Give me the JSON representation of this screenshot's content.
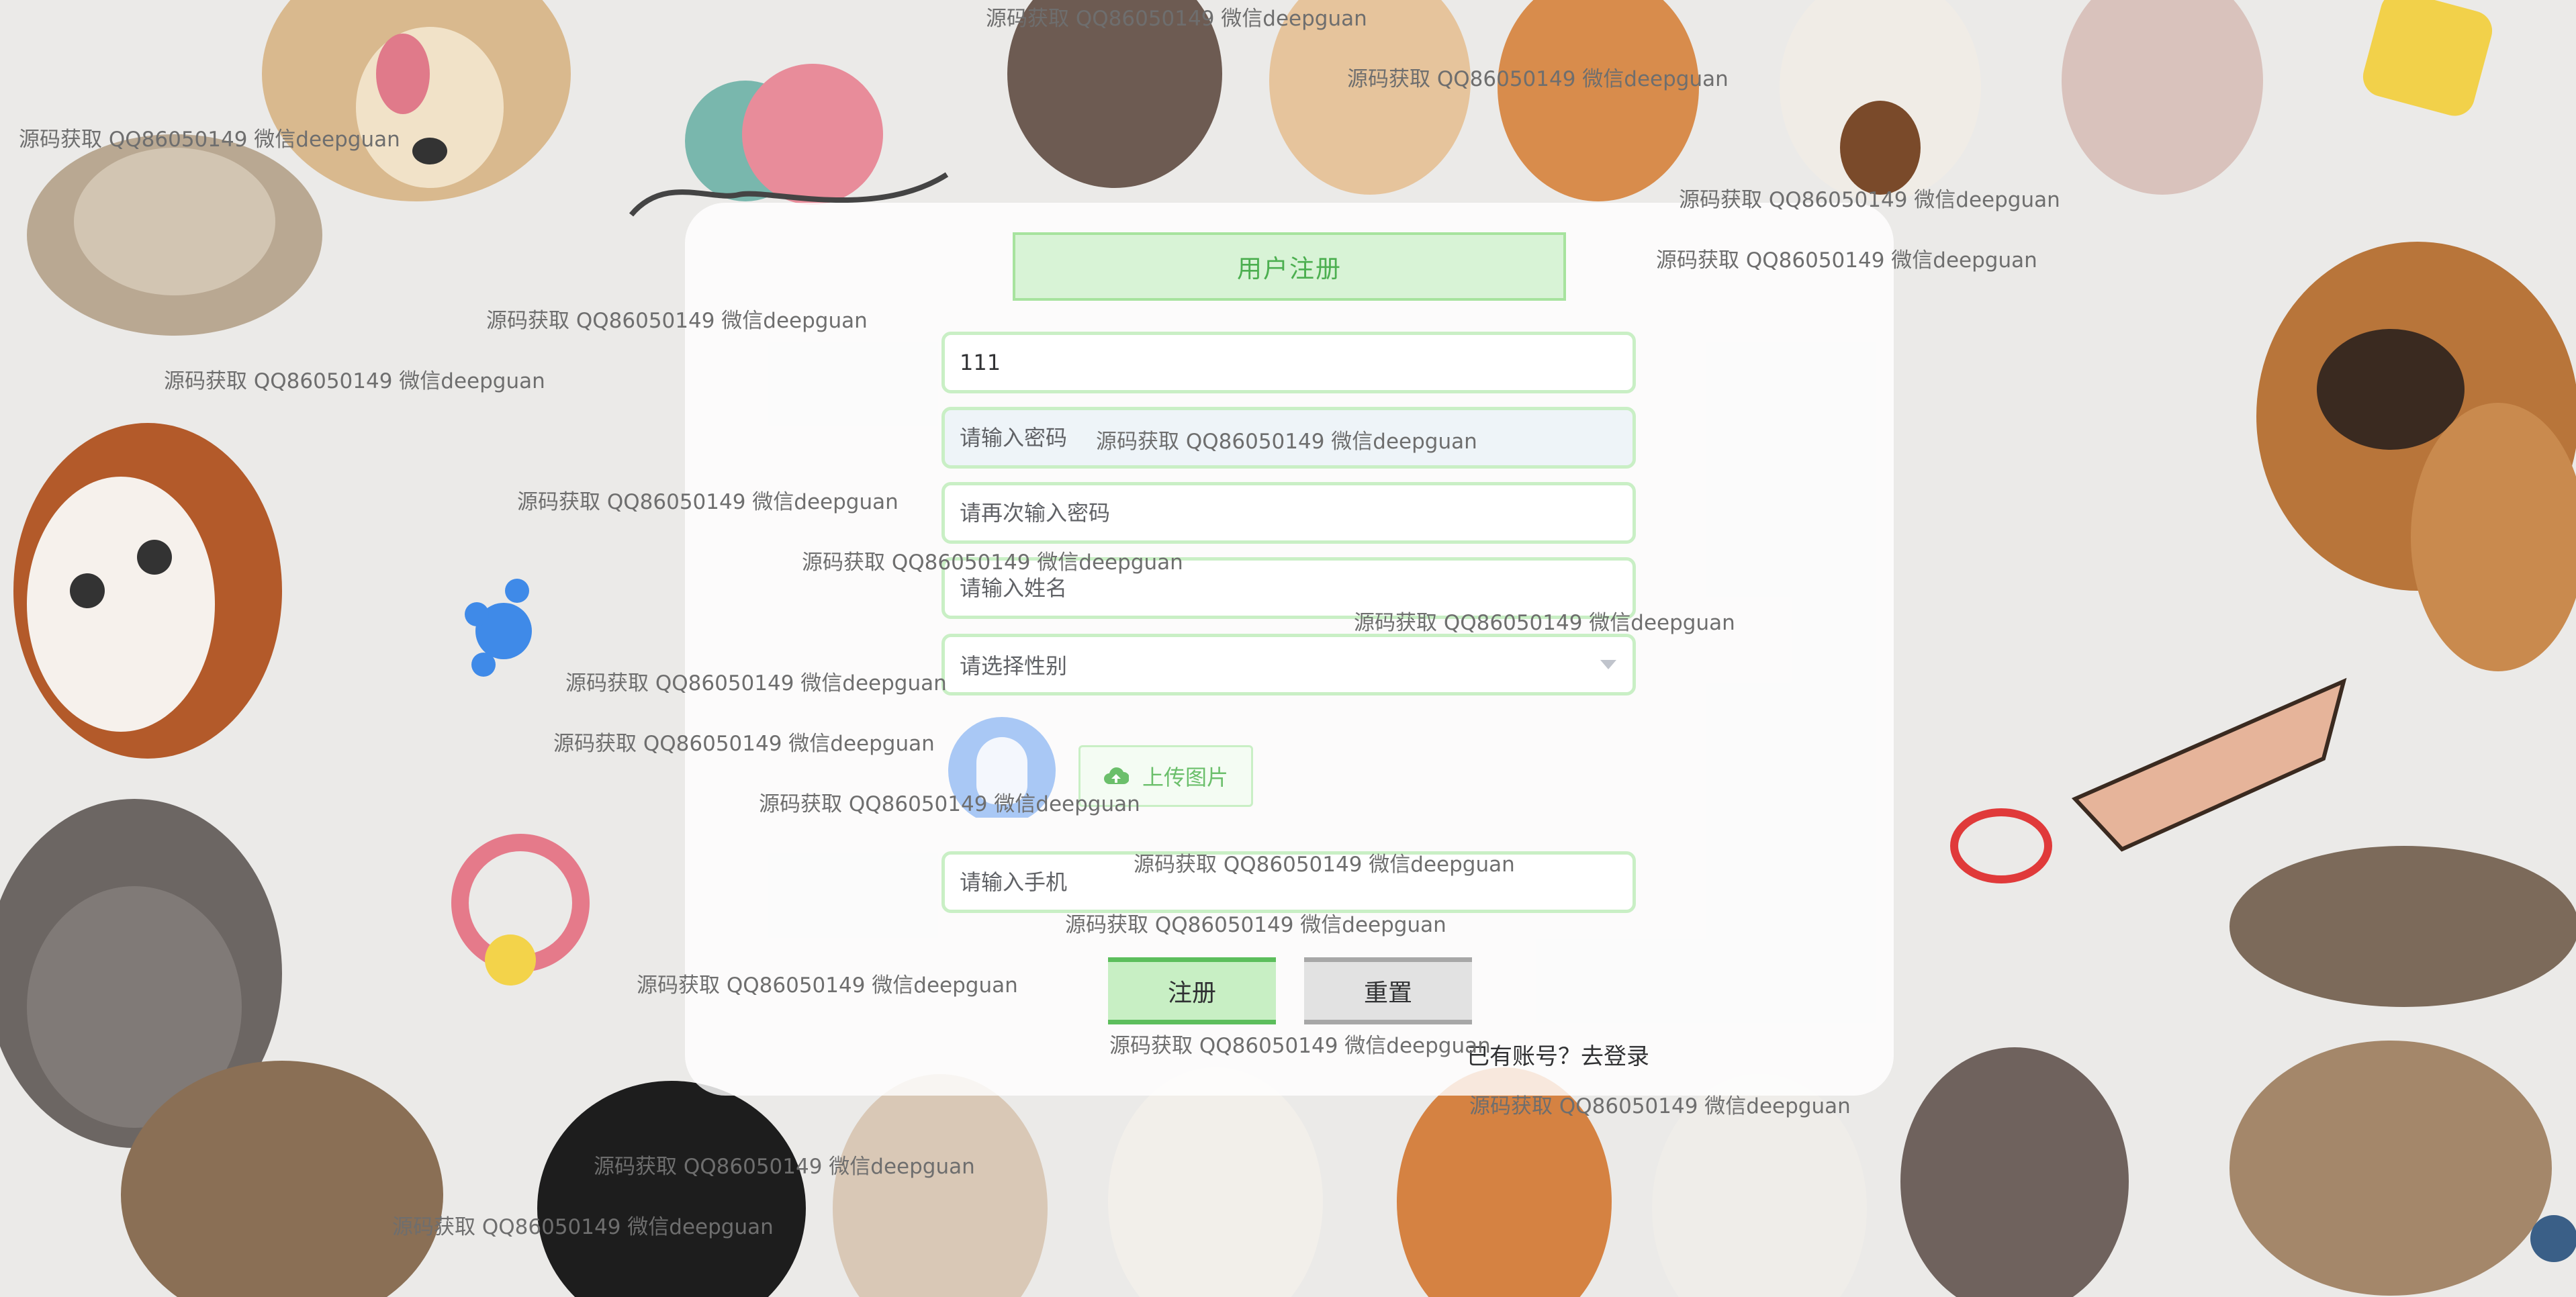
{
  "form": {
    "title": "用户注册",
    "username_value": "111",
    "password_placeholder": "请输入密码",
    "confirm_password_placeholder": "请再次输入密码",
    "name_placeholder": "请输入姓名",
    "gender_placeholder": "请选择性别",
    "upload_button_label": "上传图片",
    "phone_placeholder": "请输入手机",
    "register_button_label": "注册",
    "reset_button_label": "重置",
    "login_link_label": "已有账号？去登录"
  },
  "watermarks": [
    "源码获取 QQ86050149 微信deepguan",
    "源码获取 QQ86050149 微信deepguan",
    "源码获取 QQ86050149 微信deepguan",
    "源码获取 QQ86050149 微信deepguan",
    "源码获取 QQ86050149 微信deepguan",
    "源码获取 QQ86050149 微信deepguan",
    "源码获取 QQ86050149 微信deepguan",
    "源码获取 QQ86050149 微信deepguan",
    "源码获取 QQ86050149 微信deepguan",
    "源码获取 QQ86050149 微信deepguan",
    "源码获取 QQ86050149 微信deepguan",
    "源码获取 QQ86050149 微信deepguan",
    "源码获取 QQ86050149 微信deepguan",
    "源码获取 QQ86050149 微信deepguan",
    "源码获取 QQ86050149 微信deepguan",
    "源码获取 QQ86050149 微信deepguan",
    "源码获取 QQ86050149 微信deepguan",
    "源码获取 QQ86050149 微信deepguan",
    "源码获取 QQ86050149 微信deepguan",
    "源码获取 QQ86050149 微信deepguan",
    "源码获取 QQ86050149 微信deepguan"
  ],
  "icons": {
    "upload": "cloud-upload-icon",
    "select_caret": "chevron-down-icon",
    "avatar": "user-avatar-icon"
  },
  "colors": {
    "accent_green": "#4caf50",
    "field_border": "#c9efc5",
    "register_button": "#c8efc4",
    "reset_button": "#e2e2e2"
  }
}
